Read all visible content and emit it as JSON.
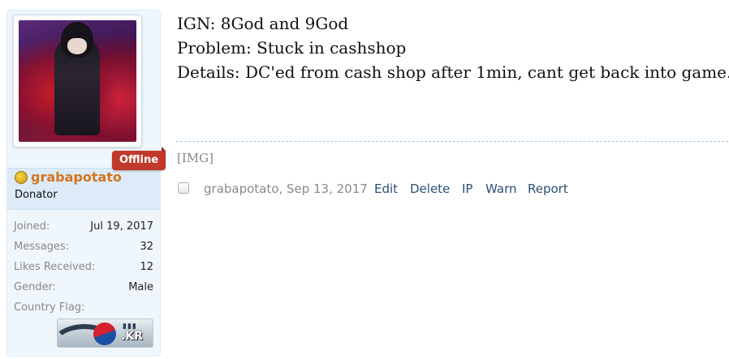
{
  "user": {
    "status_badge": "Offline",
    "username": "grabapotato",
    "title": "Donator",
    "stats": [
      {
        "label": "Joined:",
        "value": "Jul 19, 2017"
      },
      {
        "label": "Messages:",
        "value": "32"
      },
      {
        "label": "Likes Received:",
        "value": "12"
      },
      {
        "label": "Gender:",
        "value": "Male"
      },
      {
        "label": "Country Flag:",
        "value": ""
      }
    ],
    "flag_text": "KR",
    "username_color": "#d5741e"
  },
  "post": {
    "lines": [
      "IGN: 8God and 9God",
      "Problem: Stuck in cashshop",
      "Details: DC'ed from cash shop after 1min, cant get back into game."
    ],
    "signature_image_text": "[IMG]",
    "author_date": "grabapotato, Sep 13, 2017",
    "actions": {
      "edit": "Edit",
      "delete": "Delete",
      "ip": "IP",
      "warn": "Warn",
      "report": "Report"
    }
  },
  "colors": {
    "link": "#2b4f75",
    "offline_badge": "#c0392b",
    "panel_bg": "#f0f7fc"
  },
  "icons": {
    "donor": "gold-coin-icon",
    "flag": "south-korea-flag-icon"
  }
}
